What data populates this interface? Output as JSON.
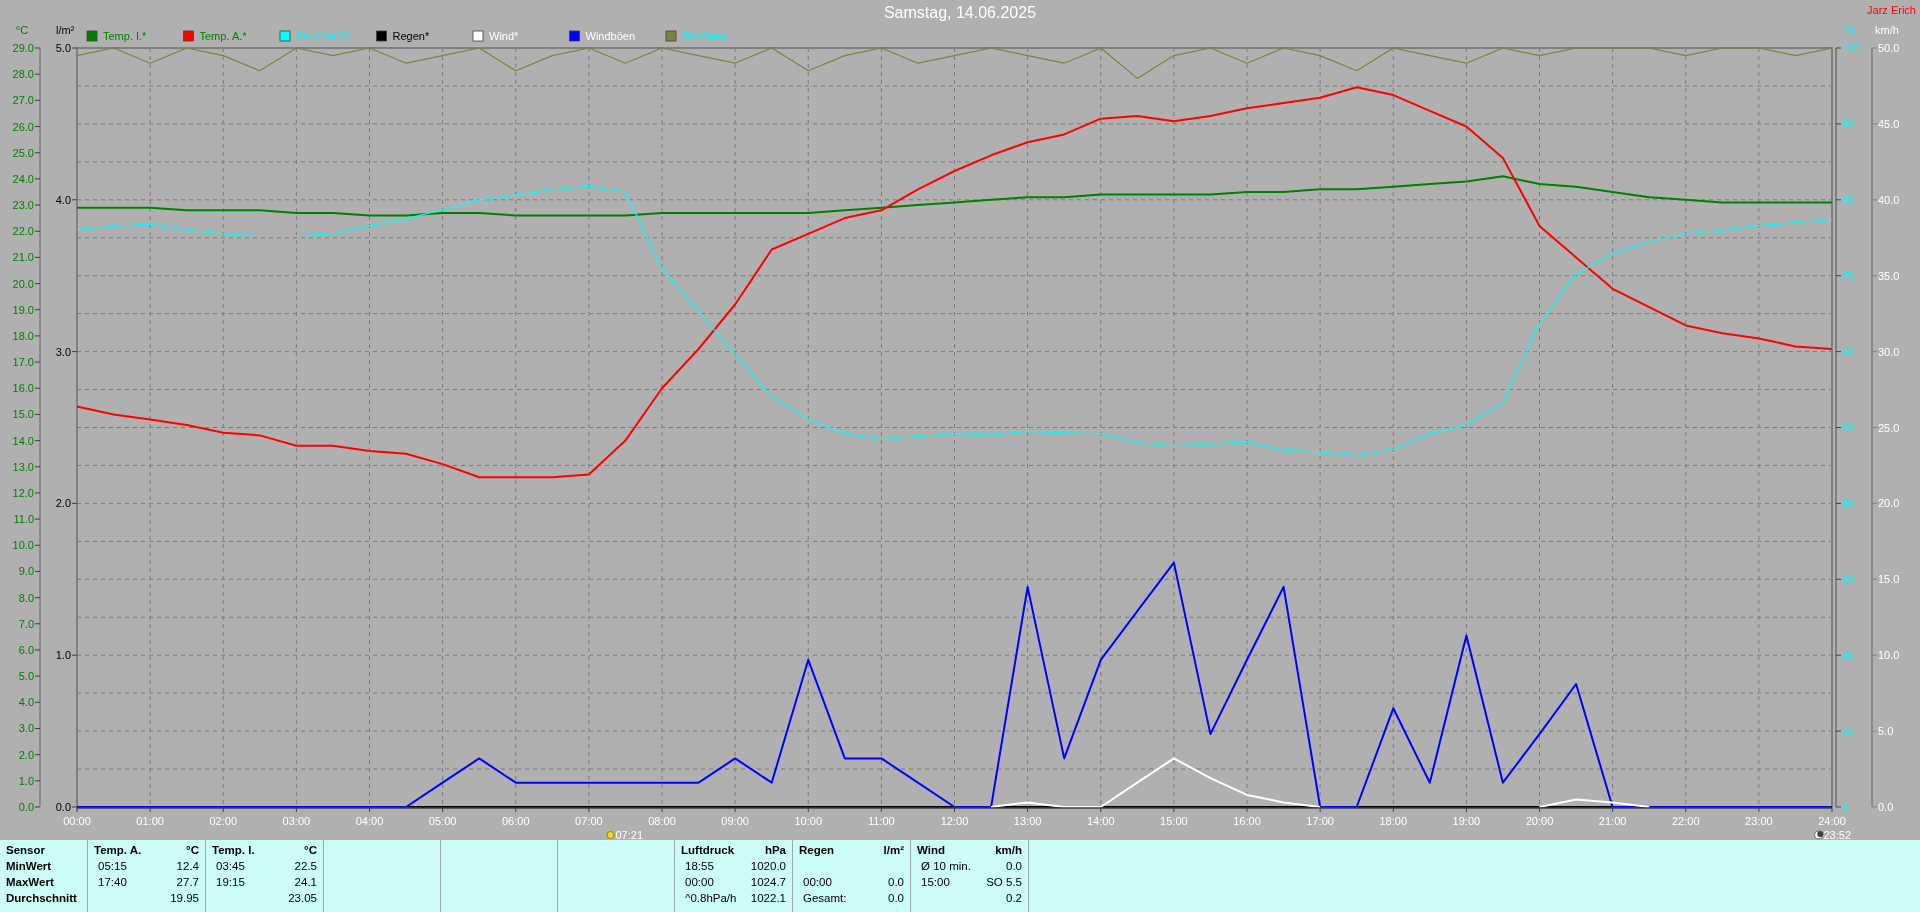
{
  "header": {
    "title": "Samstag, 14.06.2025",
    "owner": "Jarz Erich"
  },
  "chart": {
    "chart_data": {
      "type": "line",
      "xlim": [
        0,
        24
      ],
      "x": [
        0,
        0.5,
        1,
        1.5,
        2,
        2.5,
        3,
        3.5,
        4,
        4.5,
        5,
        5.5,
        6,
        6.5,
        7,
        7.5,
        8,
        8.5,
        9,
        9.5,
        10,
        10.5,
        11,
        11.5,
        12,
        12.5,
        13,
        13.5,
        14,
        14.5,
        15,
        15.5,
        16,
        16.5,
        17,
        17.5,
        18,
        18.5,
        19,
        19.5,
        20,
        20.5,
        21,
        21.5,
        22,
        22.5,
        23,
        23.5,
        24
      ],
      "xticks": [
        {
          "value": 0,
          "label": "00:00"
        },
        {
          "value": 1,
          "label": "01:00"
        },
        {
          "value": 2,
          "label": "02:00"
        },
        {
          "value": 3,
          "label": "03:00"
        },
        {
          "value": 4,
          "label": "04:00"
        },
        {
          "value": 5,
          "label": "05:00"
        },
        {
          "value": 6,
          "label": "06:00"
        },
        {
          "value": 7,
          "label": "07:00"
        },
        {
          "value": 8,
          "label": "08:00"
        },
        {
          "value": 9,
          "label": "09:00"
        },
        {
          "value": 10,
          "label": "10:00"
        },
        {
          "value": 11,
          "label": "11:00"
        },
        {
          "value": 12,
          "label": "12:00"
        },
        {
          "value": 13,
          "label": "13:00"
        },
        {
          "value": 14,
          "label": "14:00"
        },
        {
          "value": 15,
          "label": "15:00"
        },
        {
          "value": 16,
          "label": "16:00"
        },
        {
          "value": 17,
          "label": "17:00"
        },
        {
          "value": 18,
          "label": "18:00"
        },
        {
          "value": 19,
          "label": "19:00"
        },
        {
          "value": 20,
          "label": "20:00"
        },
        {
          "value": 21,
          "label": "21:00"
        },
        {
          "value": 22,
          "label": "22:00"
        },
        {
          "value": 23,
          "label": "23:00"
        },
        {
          "value": 24,
          "label": "24:00"
        }
      ],
      "ylim": [
        0,
        29
      ],
      "y2lim": [
        0,
        100
      ],
      "y3lim": [
        0,
        50
      ],
      "grid": true,
      "legend": "top",
      "yticks": [
        {
          "value": 0,
          "label": "0.0"
        },
        {
          "value": 1,
          "label": "1.0"
        },
        {
          "value": 2,
          "label": "2.0"
        },
        {
          "value": 3,
          "label": "3.0"
        },
        {
          "value": 4,
          "label": "4.0"
        },
        {
          "value": 5,
          "label": "5.0"
        },
        {
          "value": 6,
          "label": "6.0"
        },
        {
          "value": 7,
          "label": "7.0"
        },
        {
          "value": 8,
          "label": "8.0"
        },
        {
          "value": 9,
          "label": "9.0"
        },
        {
          "value": 10,
          "label": "10.0"
        },
        {
          "value": 11,
          "label": "11.0"
        },
        {
          "value": 12,
          "label": "12.0"
        },
        {
          "value": 13,
          "label": "13.0"
        },
        {
          "value": 14,
          "label": "14.0"
        },
        {
          "value": 15,
          "label": "15.0"
        },
        {
          "value": 16,
          "label": "16.0"
        },
        {
          "value": 17,
          "label": "17.0"
        },
        {
          "value": 18,
          "label": "18.0"
        },
        {
          "value": 19,
          "label": "19.0"
        },
        {
          "value": 20,
          "label": "20.0"
        },
        {
          "value": 21,
          "label": "21.0"
        },
        {
          "value": 22,
          "label": "22.0"
        },
        {
          "value": 23,
          "label": "23.0"
        },
        {
          "value": 24,
          "label": "24.0"
        },
        {
          "value": 25,
          "label": "25.0"
        },
        {
          "value": 26,
          "label": "26.0"
        },
        {
          "value": 27,
          "label": "27.0"
        },
        {
          "value": 28,
          "label": "28.0"
        },
        {
          "value": 29,
          "label": "29.0"
        }
      ],
      "y2ticks": [
        {
          "value": 0,
          "label": "0"
        },
        {
          "value": 10,
          "label": "10"
        },
        {
          "value": 20,
          "label": "20"
        },
        {
          "value": 30,
          "label": "30"
        },
        {
          "value": 40,
          "label": "40"
        },
        {
          "value": 50,
          "label": "50"
        },
        {
          "value": 60,
          "label": "60"
        },
        {
          "value": 70,
          "label": "70"
        },
        {
          "value": 80,
          "label": "80"
        },
        {
          "value": 90,
          "label": "90"
        },
        {
          "value": 100,
          "label": "100"
        }
      ],
      "y3ticks": [
        {
          "value": 0,
          "label": "0.0"
        },
        {
          "value": 5,
          "label": "5.0"
        },
        {
          "value": 10,
          "label": "10.0"
        },
        {
          "value": 15,
          "label": "15.0"
        },
        {
          "value": 20,
          "label": "20.0"
        },
        {
          "value": 25,
          "label": "25.0"
        },
        {
          "value": 30,
          "label": "30.0"
        },
        {
          "value": 35,
          "label": "35.0"
        },
        {
          "value": 40,
          "label": "40.0"
        },
        {
          "value": 45,
          "label": "45.0"
        },
        {
          "value": 50,
          "label": "50.0"
        }
      ],
      "series": [
        {
          "name": "Temp. I.*",
          "color": "#008000",
          "values": [
            22.9,
            22.9,
            22.9,
            22.8,
            22.8,
            22.8,
            22.7,
            22.7,
            22.6,
            22.6,
            22.7,
            22.7,
            22.6,
            22.6,
            22.6,
            22.6,
            22.7,
            22.7,
            22.7,
            22.7,
            22.7,
            22.8,
            22.9,
            23.0,
            23.1,
            23.2,
            23.3,
            23.3,
            23.4,
            23.4,
            23.4,
            23.4,
            23.5,
            23.5,
            23.6,
            23.6,
            23.7,
            23.8,
            23.9,
            24.1,
            23.8,
            23.7,
            23.5,
            23.3,
            23.2,
            23.1,
            23.1,
            23.1,
            23.1
          ]
        },
        {
          "name": "Temp. A.*",
          "color": "#ff0000",
          "values": [
            15.3,
            15.0,
            14.8,
            14.6,
            14.3,
            14.2,
            13.8,
            13.8,
            13.6,
            13.5,
            13.1,
            12.6,
            12.6,
            12.6,
            12.7,
            14.0,
            16.0,
            17.5,
            19.2,
            21.3,
            21.9,
            22.5,
            22.8,
            23.6,
            24.3,
            24.9,
            25.4,
            25.7,
            26.3,
            26.4,
            26.2,
            26.4,
            26.7,
            26.9,
            27.1,
            27.5,
            27.2,
            26.6,
            26.0,
            24.8,
            22.2,
            21.0,
            19.8,
            19.1,
            18.4,
            18.1,
            17.9,
            17.6,
            17.5
          ]
        },
        {
          "name": "Feuchte A.*",
          "color": "#00ffff",
          "axis": "y2",
          "values": [
            76.1,
            76.5,
            76.8,
            76.0,
            75.5,
            75.3,
            75.3,
            75.5,
            76.6,
            77.5,
            78.7,
            80.0,
            80.6,
            81.3,
            81.8,
            81.0,
            71.0,
            65.3,
            59.7,
            54.0,
            51.1,
            49.2,
            48.4,
            48.8,
            49.2,
            49.0,
            49.5,
            49.3,
            49.2,
            48.0,
            47.6,
            47.8,
            48.1,
            47.0,
            46.8,
            46.3,
            47.1,
            49.2,
            50.3,
            53.2,
            63.7,
            70.2,
            72.9,
            74.5,
            75.5,
            76.0,
            76.6,
            77.0,
            77.4
          ]
        },
        {
          "name": "Regen*",
          "color": "#000000",
          "values": [
            0,
            0,
            0,
            0,
            0,
            0,
            0,
            0,
            0,
            0,
            0,
            0,
            0,
            0,
            0,
            0,
            0,
            0,
            0,
            0,
            0,
            0,
            0,
            0,
            0,
            0,
            0,
            0,
            0,
            0,
            0,
            0,
            0,
            0,
            0,
            0,
            0,
            0,
            0,
            0,
            0,
            0,
            0,
            0,
            0,
            0,
            0,
            0,
            0
          ]
        },
        {
          "name": "Wind*",
          "color": "#ffffff",
          "axis": "y3",
          "values": [
            null,
            null,
            null,
            null,
            null,
            null,
            null,
            null,
            null,
            null,
            null,
            null,
            null,
            null,
            null,
            null,
            null,
            null,
            null,
            null,
            null,
            null,
            null,
            null,
            null,
            0,
            0.3,
            0,
            0,
            1.6,
            3.2,
            1.9,
            0.8,
            0.3,
            0,
            null,
            null,
            null,
            null,
            null,
            0,
            0.5,
            0.3,
            0,
            null,
            null,
            null,
            null,
            null
          ]
        },
        {
          "name": "Windböen",
          "color": "#0000ff",
          "axis": "y3",
          "values": [
            0,
            0,
            0,
            0,
            0,
            0,
            0,
            0,
            0,
            0,
            1.6,
            3.2,
            1.6,
            1.6,
            1.6,
            1.6,
            1.6,
            1.6,
            3.2,
            1.6,
            9.7,
            3.2,
            3.2,
            1.6,
            0,
            0,
            14.5,
            3.2,
            9.7,
            12.9,
            16.1,
            4.8,
            9.7,
            14.5,
            0,
            0,
            6.5,
            1.6,
            11.3,
            1.6,
            4.8,
            8.1,
            0,
            0,
            0,
            0,
            0,
            0,
            0
          ]
        },
        {
          "name": "Empfang",
          "color": "#808040",
          "axis": "y2",
          "values": [
            99,
            100,
            98,
            100,
            99,
            97,
            100,
            99,
            100,
            98,
            99,
            100,
            97,
            99,
            100,
            98,
            100,
            99,
            98,
            100,
            97,
            99,
            100,
            98,
            99,
            100,
            99,
            98,
            100,
            96,
            99,
            100,
            98,
            100,
            99,
            97,
            100,
            99,
            98,
            100,
            99,
            100,
            100,
            100,
            99,
            100,
            100,
            99,
            100
          ]
        }
      ],
      "annotations": [
        "07:21",
        "23:52"
      ]
    },
    "legend": [
      {
        "color": "#008000"
      },
      {
        "color": "#008000"
      },
      {
        "color": "#00ffff"
      },
      {
        "color": "#000000"
      },
      {
        "color": "#ffffff"
      },
      {
        "color": "#ffffff"
      },
      {
        "color": "#00ffff"
      }
    ],
    "axes": [
      {
        "unit": "°C"
      },
      {
        "unit": "l/m²",
        "ticks": [
          "5.0",
          "4.0",
          "3.0",
          "2.0",
          "1.0",
          "0.0"
        ]
      },
      {
        "unit": "%"
      },
      {
        "unit": "km/h"
      }
    ]
  },
  "table": {
    "row_labels": [
      "Sensor",
      "MinWert",
      "MaxWert",
      "Durchschnitt"
    ],
    "groups": [
      {
        "kind": "values",
        "title": "Temp. A.",
        "unit": "°C",
        "min": {
          "time": "05:15",
          "value": "12.4"
        },
        "max": {
          "time": "17:40",
          "value": "27.7"
        },
        "avg": {
          "value": "19.95"
        }
      },
      {
        "kind": "values",
        "title": "Temp. I.",
        "unit": "°C",
        "min": {
          "time": "03:45",
          "value": "22.5"
        },
        "max": {
          "time": "19:15",
          "value": "24.1"
        },
        "avg": {
          "value": "23.05"
        }
      },
      {
        "kind": "empty"
      },
      {
        "kind": "empty"
      },
      {
        "kind": "empty"
      },
      {
        "kind": "values",
        "title": "Luftdruck",
        "unit": "hPa",
        "min": {
          "time": "18:55",
          "value": "1020.0"
        },
        "max": {
          "time": "00:00",
          "value": "1024.7"
        },
        "avg": {
          "time": "^0.8hPa/h",
          "value": "1022.1"
        }
      },
      {
        "kind": "values",
        "title": "Regen",
        "unit": "l/m²",
        "max": {
          "time": "00:00",
          "value": "0.0"
        },
        "avg": {
          "time": "Gesamt:",
          "value": "0.0"
        }
      },
      {
        "kind": "values",
        "title": "Wind",
        "unit": "km/h",
        "min": {
          "time": "Ø 10 min.",
          "value": "0.0"
        },
        "max": {
          "time": "15:00",
          "value": "SO 5.5"
        },
        "avg": {
          "value": "0.2"
        }
      }
    ]
  }
}
